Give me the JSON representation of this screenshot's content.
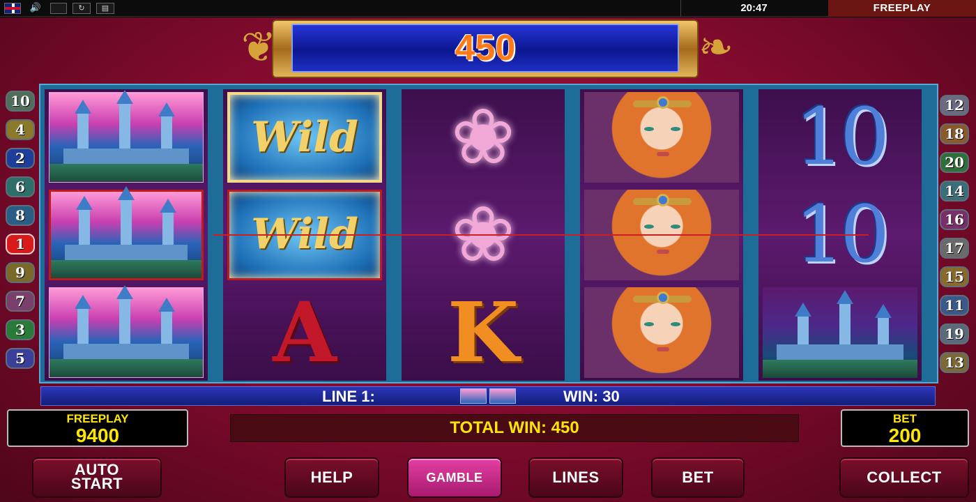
{
  "status_bar": {
    "clock": "20:47",
    "mode": "FREEPLAY",
    "icons": [
      "uk-flag-icon",
      "speaker-icon",
      "fullscreen-icon",
      "replay-icon",
      "paytable-icon"
    ]
  },
  "win_meter": {
    "value": "450"
  },
  "reels": [
    [
      "castle",
      "castle",
      "castle"
    ],
    [
      "wild",
      "wild",
      "A"
    ],
    [
      "lily",
      "lily",
      "K"
    ],
    [
      "princess",
      "princess",
      "princess"
    ],
    [
      "10",
      "10",
      "castle"
    ]
  ],
  "symbols": {
    "wild_text": "Wild",
    "a": "A",
    "k": "K",
    "ten": "10"
  },
  "line_badges": {
    "left": [
      "10",
      "4",
      "2",
      "6",
      "8",
      "1",
      "9",
      "7",
      "3",
      "5"
    ],
    "right": [
      "12",
      "18",
      "20",
      "14",
      "16",
      "17",
      "15",
      "11",
      "19",
      "13"
    ],
    "active": "1",
    "colors": {
      "1": "#d81a1a"
    }
  },
  "line_info": {
    "line": "LINE 1:",
    "win": "WIN: 30"
  },
  "credits": {
    "label": "FREEPLAY",
    "value": "9400"
  },
  "bet": {
    "label": "BET",
    "value": "200"
  },
  "total_win": "TOTAL WIN: 450",
  "buttons": {
    "auto_start_line1": "AUTO",
    "auto_start_line2": "START",
    "help": "HELP",
    "gamble": "GAMBLE",
    "lines": "LINES",
    "bet": "BET",
    "collect": "COLLECT"
  }
}
